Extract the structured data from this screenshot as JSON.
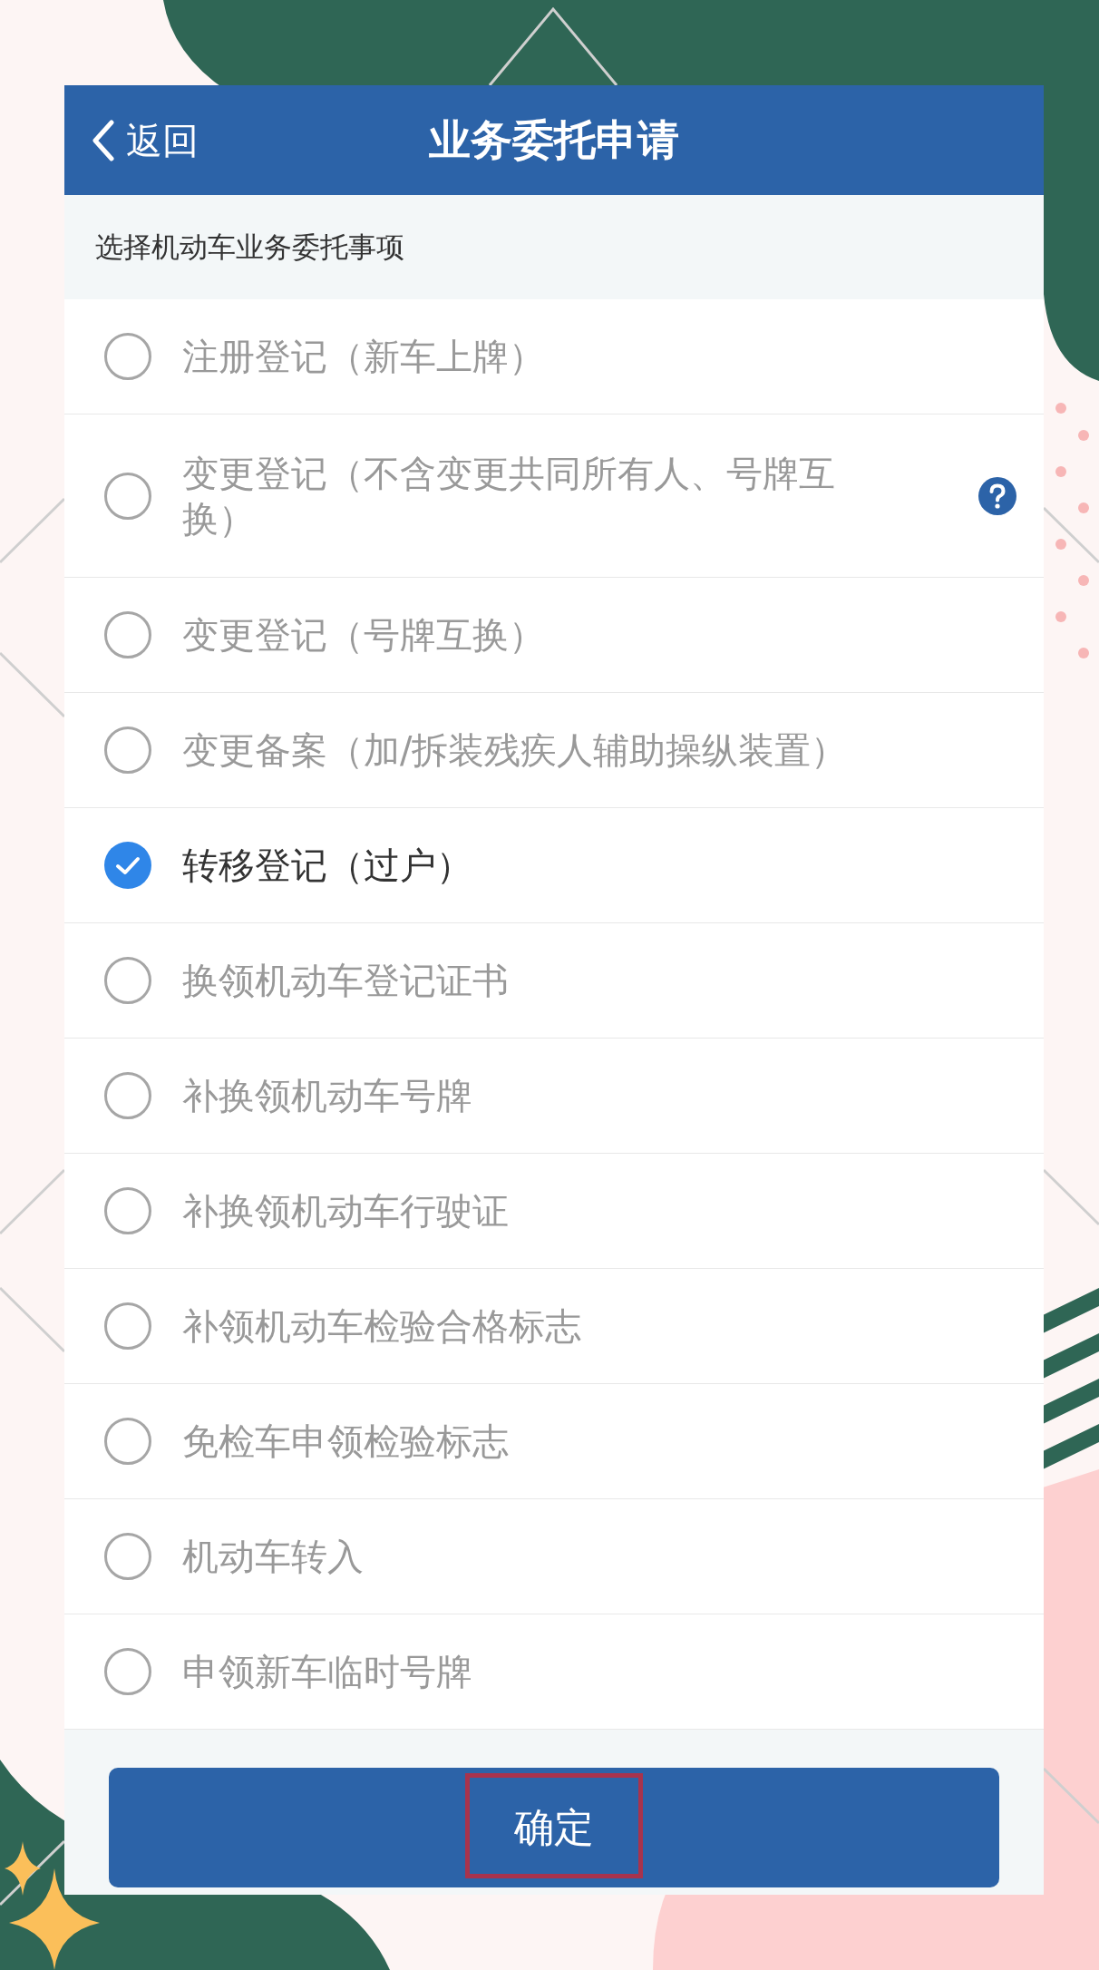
{
  "header": {
    "back_label": "返回",
    "title": "业务委托申请"
  },
  "section_label": "选择机动车业务委托事项",
  "options": [
    {
      "label": "注册登记（新车上牌）",
      "selected": false,
      "has_help": false
    },
    {
      "label": "变更登记（不含变更共同所有人、号牌互换）",
      "selected": false,
      "has_help": true
    },
    {
      "label": "变更登记（号牌互换）",
      "selected": false,
      "has_help": false
    },
    {
      "label": "变更备案（加/拆装残疾人辅助操纵装置）",
      "selected": false,
      "has_help": false
    },
    {
      "label": "转移登记（过户）",
      "selected": true,
      "has_help": false
    },
    {
      "label": "换领机动车登记证书",
      "selected": false,
      "has_help": false
    },
    {
      "label": "补换领机动车号牌",
      "selected": false,
      "has_help": false
    },
    {
      "label": "补换领机动车行驶证",
      "selected": false,
      "has_help": false
    },
    {
      "label": "补领机动车检验合格标志",
      "selected": false,
      "has_help": false
    },
    {
      "label": "免检车申领检验标志",
      "selected": false,
      "has_help": false
    },
    {
      "label": "机动车转入",
      "selected": false,
      "has_help": false
    },
    {
      "label": "申领新车临时号牌",
      "selected": false,
      "has_help": false
    }
  ],
  "confirm_button": {
    "label": "确定",
    "highlighted": true
  }
}
